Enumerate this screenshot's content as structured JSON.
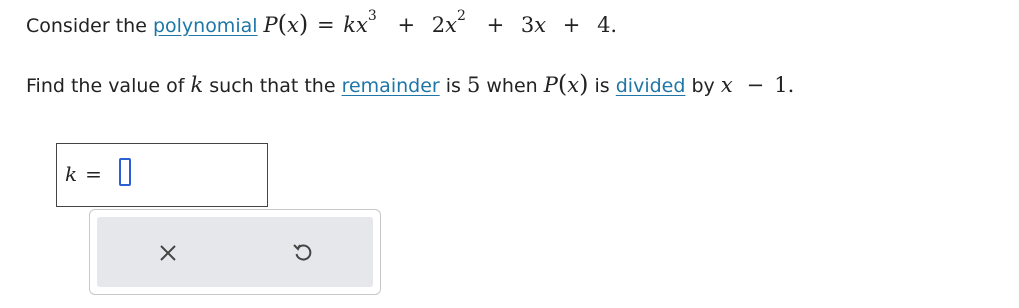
{
  "question": {
    "line1": {
      "prefix": "Consider the ",
      "term": "polynomial",
      "P": "P",
      "x": "x",
      "eq": "=",
      "k": "k",
      "x1": "x",
      "exp3": "3",
      "plus1": "+",
      "coef2": "2",
      "x2": "x",
      "exp2": "2",
      "plus2": "+",
      "coef3": "3",
      "x3": "x",
      "plus3": "+",
      "const": "4."
    },
    "line2": {
      "t1": "Find the value of ",
      "k": "k",
      "t2": " such that the ",
      "term1": "remainder",
      "t3": " is ",
      "five": "5",
      "t4": " when ",
      "P": "P",
      "x": "x",
      "t5": " is ",
      "term2": "divided",
      "t6": " by ",
      "xvar": "x",
      "minus": "−",
      "one": "1."
    }
  },
  "answer": {
    "label_var": "k",
    "label_eq": "=",
    "value": ""
  },
  "toolbar": {
    "clear_icon": "x-icon",
    "undo_icon": "undo-icon"
  },
  "colors": {
    "link": "#1e76a8",
    "cursor": "#2b5fd6",
    "toolbar_bg": "#e5e7ea"
  }
}
